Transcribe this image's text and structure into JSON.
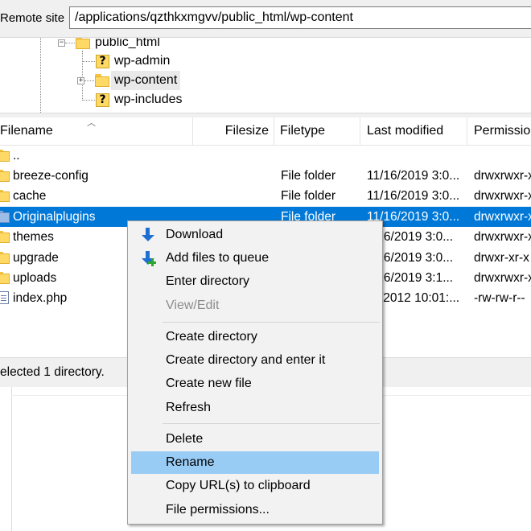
{
  "remote_site": {
    "label": "Remote site:",
    "path": "/applications/qzthkxmgvv/public_html/wp-content"
  },
  "tree": {
    "items": [
      {
        "label": "public_html",
        "icon": "folder-icon"
      },
      {
        "label": "wp-admin",
        "icon": "question-folder-icon"
      },
      {
        "label": "wp-content",
        "icon": "folder-icon",
        "selected": true
      },
      {
        "label": "wp-includes",
        "icon": "question-folder-icon"
      }
    ]
  },
  "columns": {
    "filename": "Filename",
    "filesize": "Filesize",
    "filetype": "Filetype",
    "last_modified": "Last modified",
    "permissions": "Permissions"
  },
  "files": [
    {
      "name": "..",
      "type": "",
      "modified": "",
      "perms": "",
      "icon": "folder-icon"
    },
    {
      "name": "breeze-config",
      "type": "File folder",
      "modified": "11/16/2019 3:0...",
      "perms": "drwxrwxr-x",
      "icon": "folder-icon"
    },
    {
      "name": "cache",
      "type": "File folder",
      "modified": "11/16/2019 3:0...",
      "perms": "drwxrwxr-x",
      "icon": "folder-icon"
    },
    {
      "name": "Originalplugins",
      "type": "File folder",
      "modified": "11/16/2019 3:0...",
      "perms": "drwxrwxr-x",
      "icon": "folder-icon",
      "selected": true
    },
    {
      "name": "themes",
      "type": "",
      "modified": "/16/2019 3:0...",
      "perms": "drwxrwxr-x",
      "icon": "folder-icon"
    },
    {
      "name": "upgrade",
      "type": "",
      "modified": "/16/2019 3:0...",
      "perms": "drwxr-xr-x",
      "icon": "folder-icon"
    },
    {
      "name": "uploads",
      "type": "",
      "modified": "/16/2019 3:1...",
      "perms": "drwxrwxr-x",
      "icon": "folder-icon"
    },
    {
      "name": "index.php",
      "type": "",
      "modified": "/2012 10:01:...",
      "perms": "-rw-rw-r--",
      "icon": "document-icon"
    }
  ],
  "status": {
    "text": "elected 1 directory."
  },
  "context_menu": {
    "download": "Download",
    "add_to_queue": "Add files to queue",
    "enter_directory": "Enter directory",
    "view_edit": "View/Edit",
    "create_directory": "Create directory",
    "create_directory_enter": "Create directory and enter it",
    "create_new_file": "Create new file",
    "refresh": "Refresh",
    "delete": "Delete",
    "rename": "Rename",
    "copy_urls": "Copy URL(s) to clipboard",
    "file_permissions": "File permissions..."
  },
  "colors": {
    "selection": "#0078d7",
    "menu_highlight": "#99ccf5",
    "folder": "#ffd966",
    "download_arrow": "#1e6fd1",
    "queue_plus": "#2fa62f"
  }
}
